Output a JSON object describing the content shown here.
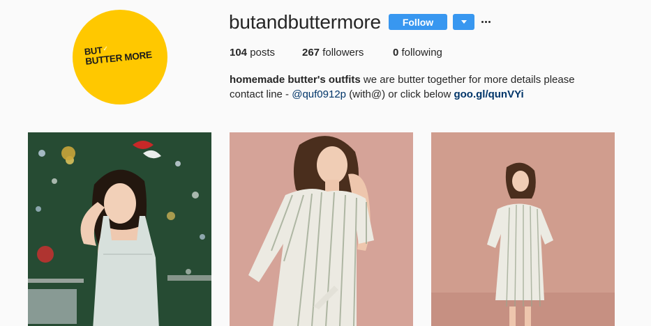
{
  "profile": {
    "username": "butandbuttermore",
    "avatar_logo_line1": "BUT",
    "avatar_logo_line2": "BUTTER MORE",
    "avatar_color": "#ffc800"
  },
  "actions": {
    "follow_label": "Follow",
    "dropdown_icon": "caret-down-icon",
    "more_icon": "ellipsis-icon",
    "accent_color": "#3897f0"
  },
  "stats": {
    "posts_count": "104",
    "posts_label": "posts",
    "followers_count": "267",
    "followers_label": "followers",
    "following_count": "0",
    "following_label": "following"
  },
  "bio": {
    "name": "homemade butter's outfits",
    "text_1": "we are butter together for more details please contact line -",
    "mention": "@quf0912p",
    "text_2": "(with@) or click below",
    "link": "goo.gl/qunVYi"
  },
  "posts": [
    {
      "scene": "woman in light sleeveless top in front of christmas tree"
    },
    {
      "scene": "woman in striped wrap dress against pink wall, close"
    },
    {
      "scene": "woman in striped wrap dress against pink wall, full body"
    }
  ]
}
